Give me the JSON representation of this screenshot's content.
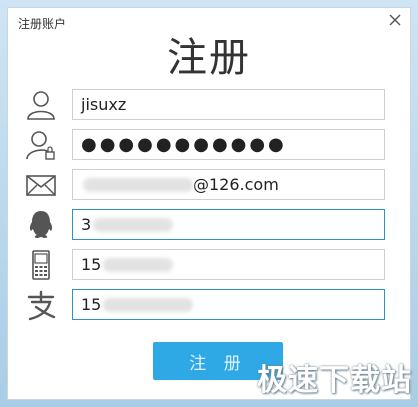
{
  "window": {
    "title": "注册账户"
  },
  "heading": "注册",
  "fields": {
    "username": {
      "value": "jisuxz"
    },
    "password": {
      "value": "●●●●●●●●●●●"
    },
    "email": {
      "value": "@126.com"
    },
    "qq": {
      "value": "3"
    },
    "phone": {
      "value": "15"
    },
    "alipay": {
      "value": "15"
    }
  },
  "register_button": "注 册",
  "watermark": {
    "text": "极速下载站"
  },
  "colors": {
    "accent": "#2fa8e6",
    "active_border": "#2b93c9"
  }
}
